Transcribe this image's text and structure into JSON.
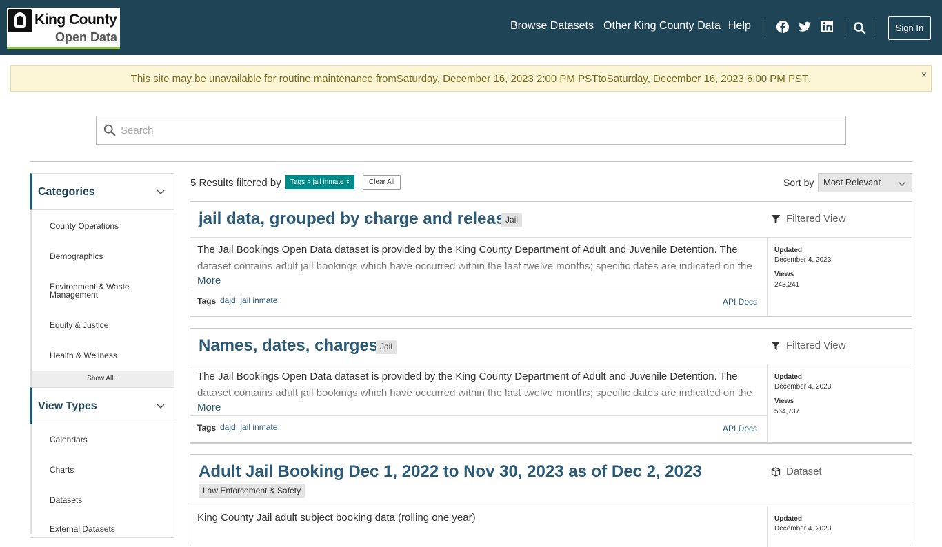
{
  "header": {
    "logo_line1": "King County",
    "logo_line2": "Open Data",
    "nav": [
      "Browse Datasets",
      "Other King County Data",
      "Help"
    ],
    "sign_in": "Sign In",
    "icons": [
      "facebook-icon",
      "twitter-icon",
      "linkedin-icon",
      "search-icon"
    ]
  },
  "banner": {
    "prefix": "This site may be unavailable for routine maintenance from",
    "start": "Saturday, December 16, 2023 2:00 PM PST",
    "middle": "to",
    "end": "Saturday, December 16, 2023 6:00 PM PST",
    "suffix": ".",
    "close": "×"
  },
  "search": {
    "placeholder": "Search"
  },
  "sidebar": {
    "categories": {
      "title": "Categories",
      "items": [
        "County Operations",
        "Demographics",
        "Environment & Waste Management",
        "Equity & Justice",
        "Health & Wellness"
      ],
      "show_all": "Show All..."
    },
    "view_types": {
      "title": "View Types",
      "items": [
        "Calendars",
        "Charts",
        "Datasets",
        "External Datasets"
      ]
    }
  },
  "results": {
    "count_text": "5 Results filtered by",
    "filter_tag": "Tags > jail inmate",
    "filter_remove": "×",
    "clear_all": "Clear All",
    "sort_label": "Sort by",
    "sort_value": "Most Relevant"
  },
  "cards": [
    {
      "title": "jail data, grouped by charge and release",
      "category": "Jail",
      "type": "Filtered View",
      "type_icon": "filter-icon",
      "description": "The Jail Bookings Open Data dataset is provided by the King County Department of Adult and Juvenile Detention. The dataset contains adult jail bookings which have occurred within the last twelve months; specific dates are indicated on the",
      "more": "More",
      "tags_label": "Tags",
      "tags": [
        "dajd",
        "jail inmate"
      ],
      "api_docs": "API Docs",
      "updated_label": "Updated",
      "updated": "December 4, 2023",
      "views_label": "Views",
      "views": "243,241"
    },
    {
      "title": "Names, dates, charges",
      "category": "Jail",
      "type": "Filtered View",
      "type_icon": "filter-icon",
      "description": "The Jail Bookings Open Data dataset is provided by the King County Department of Adult and Juvenile Detention. The dataset contains adult jail bookings which have occurred within the last twelve months; specific dates are indicated on the",
      "more": "More",
      "tags_label": "Tags",
      "tags": [
        "dajd",
        "jail inmate"
      ],
      "api_docs": "API Docs",
      "updated_label": "Updated",
      "updated": "December 4, 2023",
      "views_label": "Views",
      "views": "564,737"
    },
    {
      "title": "Adult Jail Booking Dec 1, 2022 to Nov 30, 2023 as of Dec 2, 2023",
      "category": "Law Enforcement & Safety",
      "type": "Dataset",
      "type_icon": "dataset-icon",
      "description": "King County Jail adult subject booking data (rolling one year)",
      "updated_label": "Updated",
      "updated": "December 4, 2023"
    }
  ],
  "colors": {
    "header_bg": "#1f4456",
    "accent_teal": "#008a8a",
    "link": "#2a5a78",
    "banner_bg": "#fcf6d7",
    "logo_underline": "#8dc63f"
  }
}
